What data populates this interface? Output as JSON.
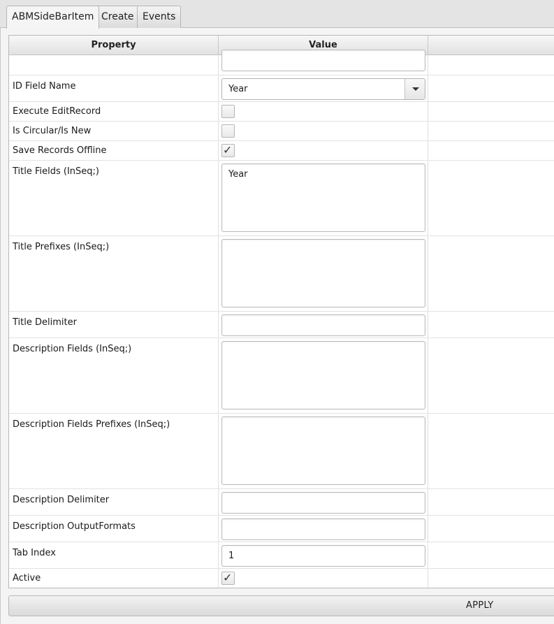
{
  "tabs": [
    {
      "label": "ABMSideBarItem",
      "active": true
    },
    {
      "label": "Create",
      "active": false
    },
    {
      "label": "Events",
      "active": false
    }
  ],
  "table": {
    "columns": [
      "Property",
      "Value"
    ],
    "rows": [
      {
        "property": "",
        "type": "text",
        "value": ""
      },
      {
        "property": "ID Field Name",
        "type": "combo",
        "value": "Year"
      },
      {
        "property": "Execute EditRecord",
        "type": "checkbox",
        "checked": false
      },
      {
        "property": "Is Circular/Is New",
        "type": "checkbox",
        "checked": false
      },
      {
        "property": "Save Records Offline",
        "type": "checkbox",
        "checked": true
      },
      {
        "property": "Title Fields (InSeq;)",
        "type": "textarea",
        "value": "Year"
      },
      {
        "property": "Title Prefixes (InSeq;)",
        "type": "textarea",
        "value": ""
      },
      {
        "property": "Title Delimiter",
        "type": "text",
        "value": ""
      },
      {
        "property": "Description Fields (InSeq;)",
        "type": "textarea",
        "value": ""
      },
      {
        "property": "Description Fields Prefixes (InSeq;)",
        "type": "textarea",
        "value": ""
      },
      {
        "property": "Description Delimiter",
        "type": "text",
        "value": ""
      },
      {
        "property": "Description OutputFormats",
        "type": "text",
        "value": ""
      },
      {
        "property": "Tab Index",
        "type": "text",
        "value": "1"
      },
      {
        "property": "Active",
        "type": "checkbox",
        "checked": true
      }
    ]
  },
  "check_glyph": "✓",
  "apply_label": "APPLY"
}
